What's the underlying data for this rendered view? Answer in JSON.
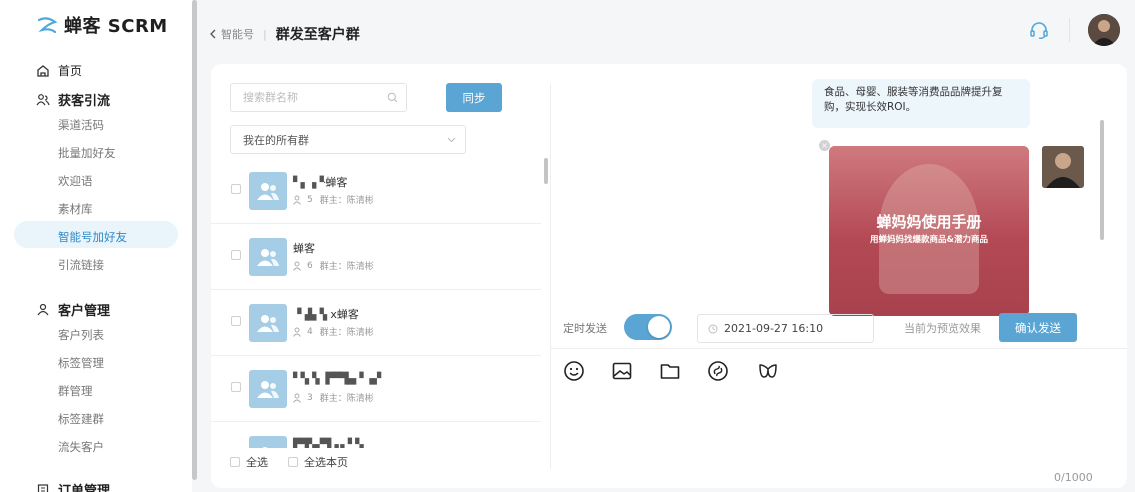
{
  "brand": {
    "logo_text": "蝉客 SCRM"
  },
  "sidebar": {
    "groups": [
      {
        "title": "首页",
        "items": []
      },
      {
        "title": "获客引流",
        "items": [
          "渠道活码",
          "批量加好友",
          "欢迎语",
          "素材库",
          "智能号加好友",
          "引流链接"
        ]
      },
      {
        "title": "客户管理",
        "items": [
          "客户列表",
          "标签管理",
          "群管理",
          "标签建群",
          "流失客户"
        ]
      },
      {
        "title": "订单管理",
        "items": []
      }
    ],
    "active_item": "智能号加好友"
  },
  "header": {
    "breadcrumb_parent": "智能号",
    "separator": "|",
    "title": "群发至客户群"
  },
  "left_panel": {
    "search_placeholder": "搜索群名称",
    "sync_label": "同步",
    "filter_value": "我在的所有群",
    "groups": [
      {
        "name": "蝉客",
        "count": "5",
        "owner": "群主：陈清彬"
      },
      {
        "name": "蝉客",
        "count": "6",
        "owner": "群主：陈清彬"
      },
      {
        "name": "x蝉客",
        "count": "4",
        "owner": "群主：陈清彬"
      },
      {
        "name": "",
        "count": "3",
        "owner": "群主：陈清彬"
      },
      {
        "name": "",
        "count": "",
        "owner": ""
      }
    ],
    "select_all_label": "全选",
    "select_page_label": "全选本页"
  },
  "preview": {
    "message_text": "食品、母婴、服装等消费品品牌提升复购，实现长效ROI。",
    "media_title": "蝉妈妈使用手册",
    "media_subtitle": "用蝉妈妈找爆款商品&潜力商品",
    "close_glyph": "×"
  },
  "schedule": {
    "label": "定时发送",
    "enabled": true,
    "datetime": "2021-09-27 16:10",
    "preview_note": "当前为预览效果",
    "confirm_label": "确认发送"
  },
  "editor": {
    "tools": [
      "emoji-icon",
      "image-icon",
      "folder-icon",
      "link-icon",
      "miniprogram-icon"
    ],
    "counter": "0/1000"
  },
  "colors": {
    "accent": "#5aa5d4",
    "active_bg": "#e9f4fb",
    "active_text": "#2d8ac8"
  }
}
